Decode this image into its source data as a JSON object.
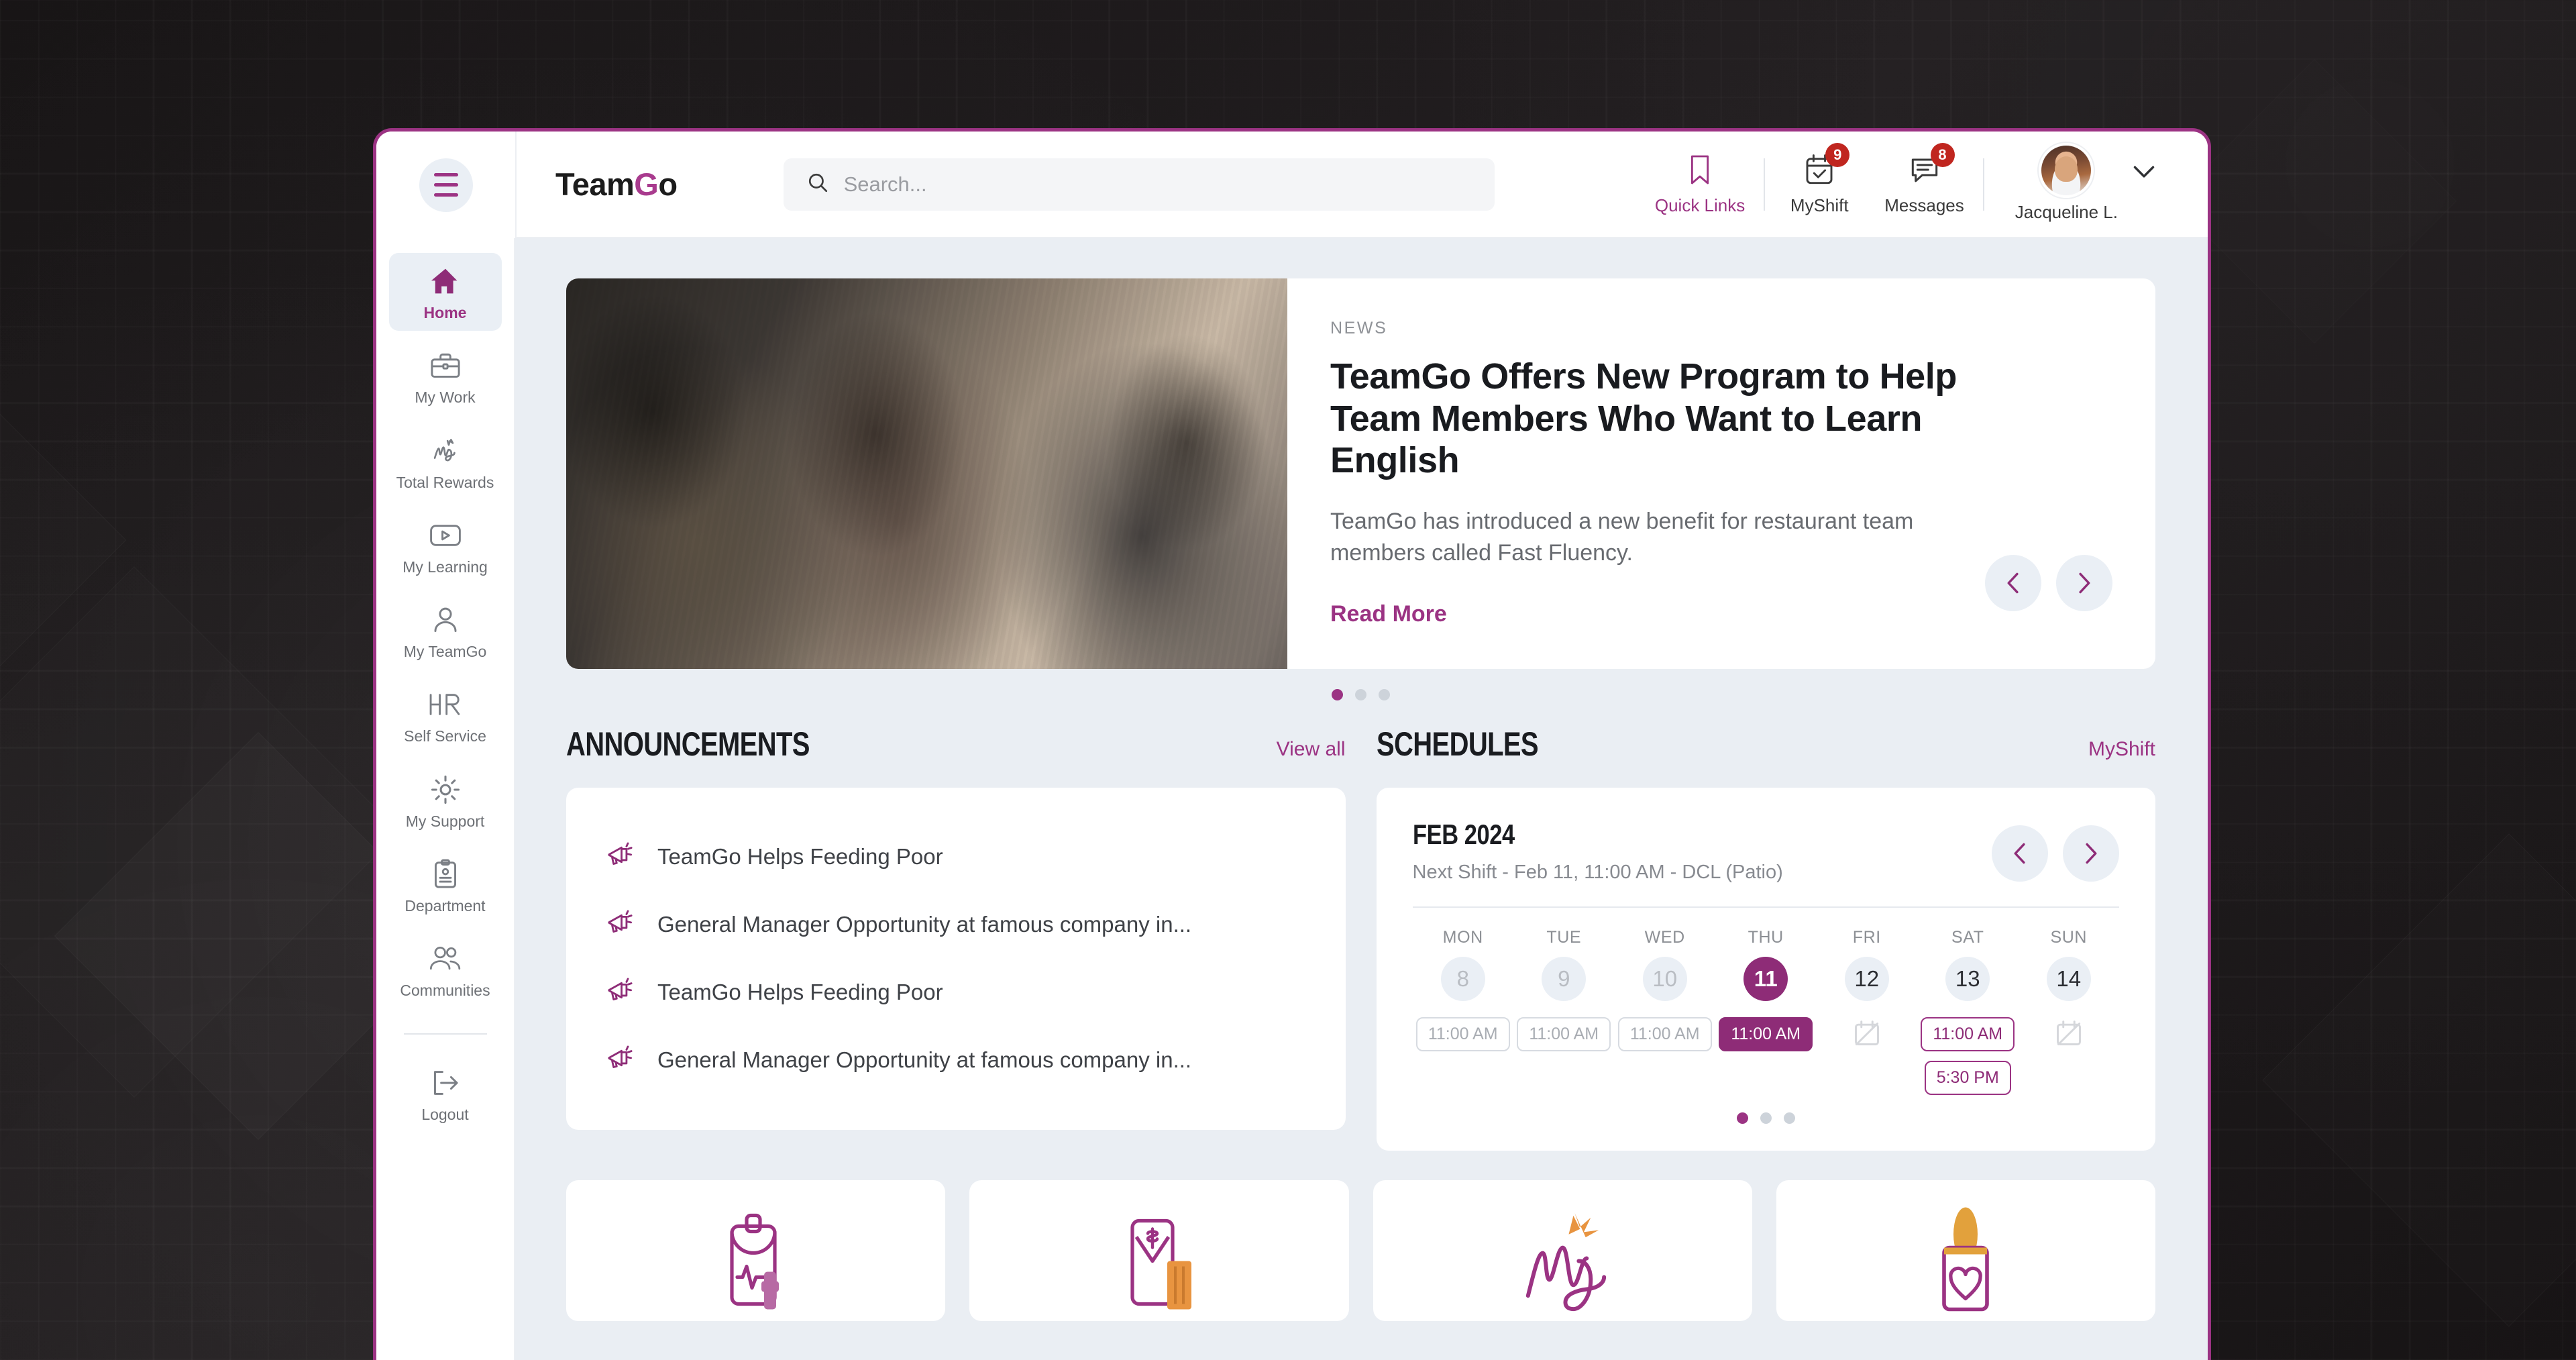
{
  "brand": {
    "name_prefix": "Team",
    "name_accent": "G",
    "name_suffix": "o"
  },
  "search": {
    "placeholder": "Search...",
    "value": "",
    "icon": "search-icon"
  },
  "topbar": {
    "actions": [
      {
        "label": "Quick Links",
        "icon": "bookmark-icon",
        "badge": ""
      },
      {
        "label": "MyShift",
        "icon": "calendar-check-icon",
        "badge": "9"
      },
      {
        "label": "Messages",
        "icon": "message-lines-icon",
        "badge": "8"
      }
    ],
    "user": {
      "name": "Jacqueline L.",
      "icon": "avatar",
      "chevron": "chevron-down-icon"
    }
  },
  "sidebar": {
    "menu_icon": "hamburger-icon",
    "items": [
      {
        "label": "Home",
        "icon": "home-icon",
        "active": true
      },
      {
        "label": "My Work",
        "icon": "briefcase-icon",
        "active": false
      },
      {
        "label": "Total Rewards",
        "icon": "my-script-icon",
        "active": false
      },
      {
        "label": "My Learning",
        "icon": "play-video-icon",
        "active": false
      },
      {
        "label": "My TeamGo",
        "icon": "person-icon",
        "active": false
      },
      {
        "label": "Self Service",
        "icon": "hr-icon",
        "active": false
      },
      {
        "label": "My Support",
        "icon": "gear-icon",
        "active": false
      },
      {
        "label": "Department",
        "icon": "clipboard-icon",
        "active": false
      },
      {
        "label": "Communities",
        "icon": "people-icon",
        "active": false
      }
    ],
    "logout": {
      "label": "Logout",
      "icon": "logout-icon"
    }
  },
  "news": {
    "kicker": "NEWS",
    "title": "TeamGo Offers New Program to Help Team Members Who Want to Learn English",
    "description": "TeamGo has introduced a new benefit for restaurant team members called Fast Fluency.",
    "read_more": "Read More",
    "prev_icon": "chevron-left-icon",
    "next_icon": "chevron-right-icon",
    "dots": 3,
    "active_dot": 0
  },
  "announcements": {
    "title": "ANNOUNCEMENTS",
    "view_all": "View all",
    "items": [
      {
        "text": "TeamGo Helps Feeding Poor",
        "icon": "megaphone-icon"
      },
      {
        "text": "General Manager Opportunity at famous company in...",
        "icon": "megaphone-icon"
      },
      {
        "text": "TeamGo Helps Feeding Poor",
        "icon": "megaphone-icon"
      },
      {
        "text": "General Manager Opportunity at famous company in...",
        "icon": "megaphone-icon"
      }
    ]
  },
  "schedules": {
    "title": "SCHEDULES",
    "link": "MyShift",
    "month": "FEB 2024",
    "next_shift": "Next Shift - Feb 11, 11:00 AM - DCL (Patio)",
    "prev_icon": "chevron-left-icon",
    "next_icon": "chevron-right-icon",
    "dots": 3,
    "active_dot": 0,
    "week": [
      {
        "name": "MON",
        "num": "8",
        "state": "past",
        "shifts": [
          "11:00 AM"
        ],
        "shift_style": "muted"
      },
      {
        "name": "TUE",
        "num": "9",
        "state": "past",
        "shifts": [
          "11:00 AM"
        ],
        "shift_style": "muted"
      },
      {
        "name": "WED",
        "num": "10",
        "state": "past",
        "shifts": [
          "11:00 AM"
        ],
        "shift_style": "muted"
      },
      {
        "name": "THU",
        "num": "11",
        "state": "today",
        "shifts": [
          "11:00 AM"
        ],
        "shift_style": "filled"
      },
      {
        "name": "FRI",
        "num": "12",
        "state": "present",
        "shifts": [],
        "shift_style": "none"
      },
      {
        "name": "SAT",
        "num": "13",
        "state": "present",
        "shifts": [
          "11:00 AM",
          "5:30 PM"
        ],
        "shift_style": "accent"
      },
      {
        "name": "SUN",
        "num": "14",
        "state": "present",
        "shifts": [],
        "shift_style": "none"
      }
    ]
  },
  "quick_cards": [
    {
      "icon": "health-phone-icon"
    },
    {
      "icon": "pay-money-icon"
    },
    {
      "icon": "my-rewards-icon"
    },
    {
      "icon": "wellbeing-heart-icon"
    }
  ],
  "colors": {
    "accent": "#9b3383",
    "accent_dark": "#8e2c77",
    "badge": "#c0261f",
    "surface": "#ffffff",
    "canvas": "#eaeef3",
    "desktop": "#1a1718",
    "orange": "#e89440"
  }
}
